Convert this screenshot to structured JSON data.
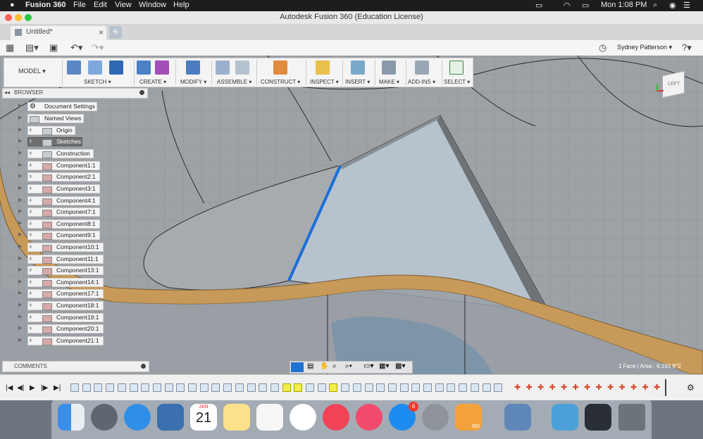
{
  "menubar": {
    "app_name": "Fusion 360",
    "menus": [
      "File",
      "Edit",
      "View",
      "Window",
      "Help"
    ],
    "clock": "Mon 1:08 PM"
  },
  "window": {
    "title": "Autodesk Fusion 360 (Education License)"
  },
  "tabs": {
    "doc_tab_label": "Untitled*",
    "new_tab": "+"
  },
  "quickbar": {
    "user_name": "Sydney Patterson ▾",
    "help": "?▾"
  },
  "toolbar": {
    "workspace": "MODEL ▾",
    "groups": [
      {
        "label": "SKETCH ▾"
      },
      {
        "label": "CREATE ▾"
      },
      {
        "label": "MODIFY ▾"
      },
      {
        "label": "ASSEMBLE ▾"
      },
      {
        "label": "CONSTRUCT ▾"
      },
      {
        "label": "INSPECT ▾"
      },
      {
        "label": "INSERT ▾"
      },
      {
        "label": "MAKE ▾"
      },
      {
        "label": "ADD-INS ▾"
      },
      {
        "label": "SELECT ▾"
      }
    ]
  },
  "browser": {
    "title": "BROWSER",
    "collapse": "◂◂",
    "nodes": [
      {
        "label": "Document Settings"
      },
      {
        "label": "Named Views"
      },
      {
        "label": "Origin"
      },
      {
        "label": "Sketches"
      },
      {
        "label": "Construction"
      },
      {
        "label": "Component1:1"
      },
      {
        "label": "Component2:1"
      },
      {
        "label": "Component3:1"
      },
      {
        "label": "Component4:1"
      },
      {
        "label": "Component7:1"
      },
      {
        "label": "Component8:1"
      },
      {
        "label": "Component9:1"
      },
      {
        "label": "Component10:1"
      },
      {
        "label": "Component11:1"
      },
      {
        "label": "Component13:1"
      },
      {
        "label": "Component14:1"
      },
      {
        "label": "Component17:1"
      },
      {
        "label": "Component18:1"
      },
      {
        "label": "Component19:1"
      },
      {
        "label": "Component20:1"
      },
      {
        "label": "Component21:1"
      }
    ]
  },
  "viewcube": {
    "face": "LEFT"
  },
  "comments": {
    "title": "COMMENTS"
  },
  "status_text": "1 Face | Area : 6.193 ft^2",
  "dock": {
    "calendar_month": "JAN",
    "calendar_day": "21",
    "appstore_badge": "6",
    "fusion_label": "360"
  },
  "colors": {
    "accent": "#0a6fd6",
    "menubar": "#1d1d1d",
    "wood": "#c79a5a",
    "concrete": "#9ea3a8"
  }
}
